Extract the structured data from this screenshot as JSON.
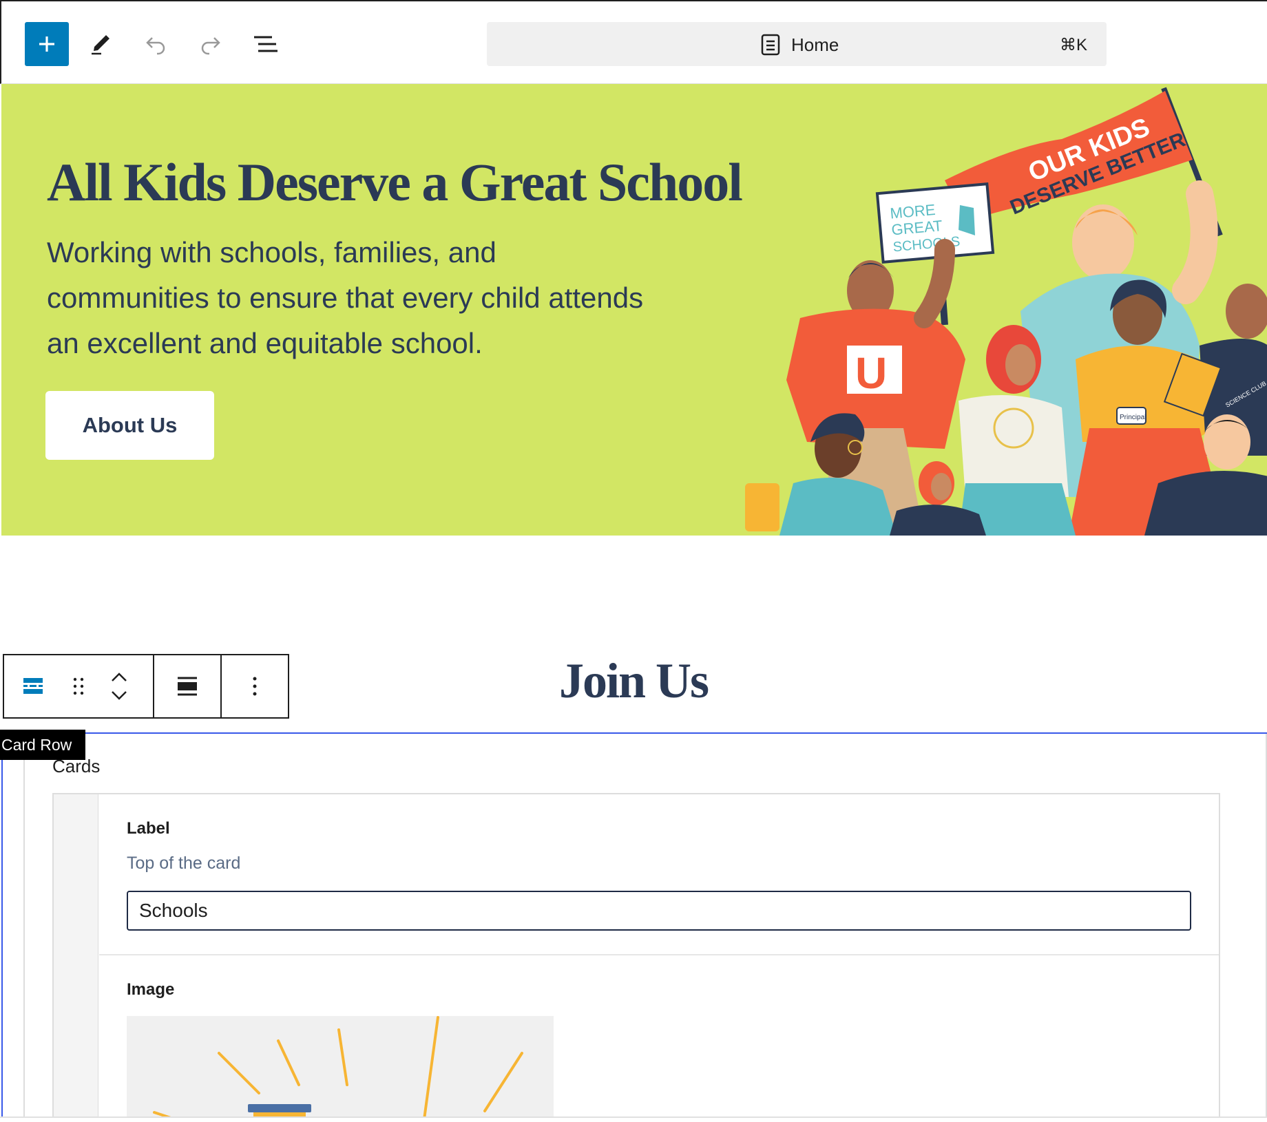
{
  "toolbar": {
    "add_icon": "plus-icon",
    "tools_icon": "pencil-icon",
    "undo_icon": "undo-icon",
    "redo_icon": "redo-icon",
    "list_view_icon": "list-view-icon",
    "command": {
      "title": "Home",
      "shortcut": "⌘K",
      "icon": "page-icon"
    }
  },
  "hero": {
    "title": "All Kids Deserve a Great School",
    "text": "Working with schools, families, and communities to ensure that every child attends an excellent and equitable school.",
    "button": "About Us",
    "background": "#d2e664",
    "illustration": {
      "banner_text_1": "OUR KIDS",
      "banner_text_2": "DESERVE BETTER",
      "sign_line_1": "MORE",
      "sign_line_2": "GREAT",
      "sign_line_3": "SCHOOLS",
      "shirt_letter": "U",
      "badge_text": "Principal",
      "book_text": "SCIENCE CLUB"
    }
  },
  "join": {
    "title": "Join Us"
  },
  "block_toolbar": {
    "block_type_icon": "card-row-icon",
    "drag_icon": "drag-handle-icon",
    "move_icons": [
      "chevron-up-icon",
      "chevron-down-icon"
    ],
    "align_icon": "align-wide-icon",
    "options_icon": "more-vertical-icon",
    "tooltip": "Card Row"
  },
  "cards": {
    "title": "Cards",
    "label_field": {
      "label": "Label",
      "description": "Top of the card",
      "value": "Schools"
    },
    "image_field": {
      "label": "Image"
    }
  },
  "colors": {
    "accent": "#007cba",
    "selection": "#3858e9",
    "heading": "#2b3a55"
  }
}
